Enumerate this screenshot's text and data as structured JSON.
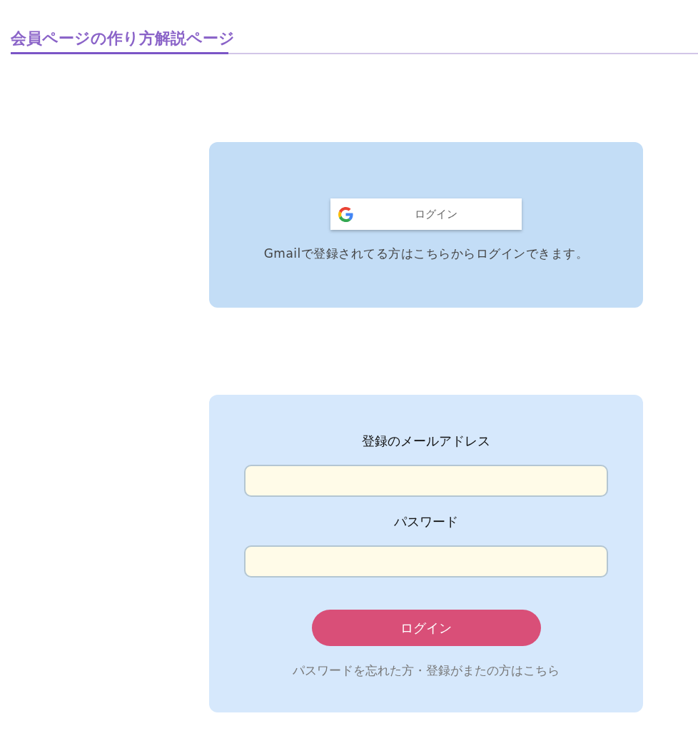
{
  "heading": {
    "title": "会員ページの作り方解説ページ"
  },
  "google_card": {
    "button": {
      "label": "ログイン"
    },
    "note": "Gmailで登録されてる方はこちらからログインできます。"
  },
  "login_form": {
    "fields": [
      {
        "label": "登録のメールアドレス"
      },
      {
        "label": "パスワード"
      }
    ],
    "submit": {
      "label": "ログイン"
    },
    "link": "パスワードを忘れた方・登録がまたの方はこちら"
  }
}
